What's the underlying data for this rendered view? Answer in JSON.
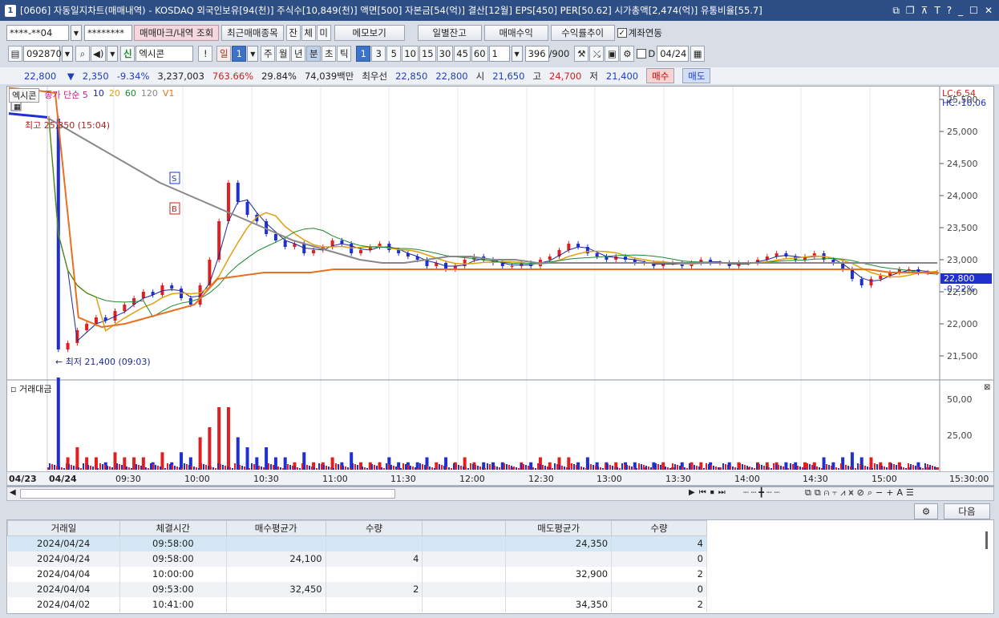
{
  "window": {
    "number": "1",
    "title": "[0606] 자동일지차트(매매내역) - KOSDAQ 외국인보유[94(천)] 주식수[10,849(천)] 액면[500] 자본금[54(억)] 결산[12월] EPS[450] PER[50.62] 시가총액[2,474(억)] 유통비율[55.7]"
  },
  "toolbar1": {
    "account": "****-**04",
    "password": "********",
    "trade_mark_btn": "매매마크/내역 조회",
    "recent_btn": "최근매매종목",
    "jan": "잔",
    "che": "체",
    "mi": "미",
    "memo_btn": "메모보기",
    "daily_balance_btn": "일별잔고",
    "profit_btn": "매매수익",
    "return_btn": "수익률추이",
    "link_label": "계좌연동"
  },
  "toolbar2": {
    "code": "092870",
    "badge": "신",
    "stock_name": "엑시콘",
    "bang": "!",
    "day": "일",
    "day_val": "1",
    "periods": [
      "주",
      "월",
      "년"
    ],
    "min": "분",
    "cho": "초",
    "tick": "틱",
    "intervals": [
      "1",
      "3",
      "5",
      "10",
      "15",
      "30",
      "45",
      "60"
    ],
    "selected_interval": "1",
    "count_val": "1",
    "bars": "396",
    "bars_max": "/900",
    "d_label": "D",
    "date": "04/24"
  },
  "pricebar": {
    "price": "22,800",
    "change": "2,350",
    "change_pct": "-9.34%",
    "volume": "3,237,003",
    "vol_ratio": "763.66%",
    "turnover": "29.84%",
    "amount": "74,039백만",
    "best_label": "최우선",
    "ask": "22,850",
    "bid": "22,800",
    "open_label": "시",
    "open": "21,650",
    "high_label": "고",
    "high": "24,700",
    "low_label": "저",
    "low": "21,400",
    "buy_btn": "매수",
    "sell_btn": "매도"
  },
  "chart_legend": {
    "name": "엑시콘",
    "ma_label": "종가 단순",
    "ma5": "5",
    "ma10": "10",
    "ma20": "20",
    "ma60": "60",
    "ma120": "120",
    "v1": "V1",
    "lc": "LC:6,54",
    "hc": "HC:-10,06",
    "high_note": "최고 25,350 (15:04)",
    "low_note": "최저 21,400 (09:03)",
    "vol_title": "거래대금",
    "current_price": "22,800",
    "current_pct": "-0.22%",
    "sell_mark": "S",
    "buy_mark": "B",
    "prev_date": "04/23",
    "cur_date": "04/24",
    "time_end": "15:30:00"
  },
  "colors": {
    "up": "#e02020",
    "down": "#2030d0",
    "ma5": "#1a2a9a",
    "ma10": "#1a8a30",
    "ma20": "#e0a010",
    "ma60": "#888888",
    "v1": "#e87020"
  },
  "chart_data": {
    "type": "candlestick",
    "y_ticks": [
      "25,500",
      "25,000",
      "24,500",
      "24,000",
      "23,500",
      "23,000",
      "22,500",
      "22,000",
      "21,500"
    ],
    "ylim": [
      21200,
      25700
    ],
    "vol_ticks": [
      "50,00",
      "25,00"
    ],
    "x_ticks": [
      "09:30",
      "10:00",
      "10:30",
      "11:00",
      "11:30",
      "12:00",
      "12:30",
      "13:00",
      "13:30",
      "14:00",
      "14:30",
      "15:00"
    ],
    "prev_day_close_line": [
      25280,
      25260,
      25240,
      25220
    ],
    "close_path": [
      25200,
      21600,
      21700,
      21900,
      22000,
      22100,
      22050,
      22200,
      22300,
      22400,
      22500,
      22450,
      22600,
      22550,
      22400,
      22300,
      22600,
      23000,
      23600,
      24200,
      23900,
      23700,
      23600,
      23400,
      23300,
      23200,
      23250,
      23100,
      23150,
      23200,
      23300,
      23250,
      23100,
      23150,
      23200,
      23250,
      23150,
      23100,
      23050,
      23000,
      22900,
      22950,
      22850,
      22900,
      23000,
      23050,
      23000,
      22950,
      22900,
      22900,
      22950,
      22900,
      23000,
      23050,
      23150,
      23250,
      23200,
      23100,
      23050,
      23000,
      23050,
      23000,
      22950,
      22950,
      22900,
      22950,
      22950,
      22900,
      22950,
      23000,
      22950,
      22950,
      22900,
      22950,
      22950,
      23000,
      23050,
      23100,
      23050,
      23000,
      23050,
      23100,
      23000,
      22950,
      22850,
      22700,
      22600,
      22700,
      22750,
      22800,
      22850,
      22850,
      22800,
      22800,
      22800
    ],
    "ma60_path": [
      25200,
      25000,
      24800,
      24600,
      24400,
      24200,
      24050,
      23900,
      23750,
      23600,
      23450,
      23300,
      23200,
      23100,
      23000,
      22950,
      22950,
      23000,
      23050,
      23050,
      23000,
      23000,
      22950,
      22950,
      22950,
      22950,
      22950,
      22950,
      22950,
      22950,
      22950,
      22950,
      22950,
      22950,
      22950,
      22950,
      22950,
      22950,
      22950,
      22950,
      22950
    ],
    "v1_path": [
      25680,
      25650,
      25600,
      22100,
      21950,
      22000,
      22100,
      22200,
      22300,
      22700,
      22750,
      22800,
      22800,
      22800,
      22850,
      22850,
      22850,
      22850,
      22850,
      22850,
      22850,
      22850,
      22850,
      22850,
      22850,
      22850,
      22850,
      22850,
      22850,
      22850,
      22850,
      22850,
      22850,
      22850,
      22850,
      22850,
      22850,
      22850,
      22800,
      22800,
      22800
    ]
  },
  "bottom": {
    "next_btn": "다음",
    "columns": [
      "거래일",
      "체결시간",
      "매수평균가",
      "수량",
      "",
      "매도평균가",
      "수량"
    ],
    "rows": [
      [
        "2024/04/24",
        "09:58:00",
        "",
        "",
        "",
        "24,350",
        "4"
      ],
      [
        "2024/04/24",
        "09:58:00",
        "24,100",
        "4",
        "",
        "",
        "0"
      ],
      [
        "2024/04/04",
        "10:00:00",
        "",
        "",
        "",
        "32,900",
        "2"
      ],
      [
        "2024/04/04",
        "09:53:00",
        "32,450",
        "2",
        "",
        "",
        "0"
      ],
      [
        "2024/04/02",
        "10:41:00",
        "",
        "",
        "",
        "34,350",
        "2"
      ]
    ]
  }
}
